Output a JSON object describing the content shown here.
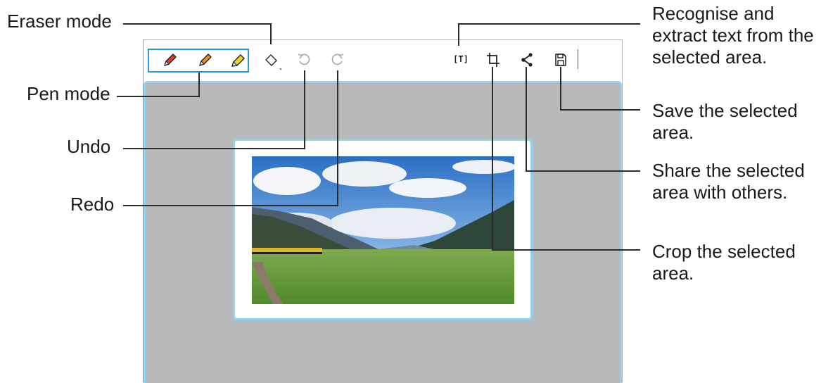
{
  "callouts": {
    "eraser": "Eraser mode",
    "pen": "Pen mode",
    "undo": "Undo",
    "redo": "Redo",
    "recognise": [
      "Recognise and",
      "extract text from the",
      "selected area."
    ],
    "save": [
      "Save the selected",
      "area."
    ],
    "share": [
      "Share the selected",
      "area with others."
    ],
    "crop": [
      "Crop the selected",
      "area."
    ]
  },
  "toolbar": {
    "icons": [
      "red-pen-icon",
      "orange-pen-icon",
      "yellow-highlighter-icon",
      "eraser-icon",
      "undo-icon",
      "redo-icon",
      "text-recognition-icon",
      "crop-icon",
      "share-icon",
      "save-icon"
    ],
    "text_recognition_glyph": "[T]"
  },
  "colors": {
    "callout_box": "#2a9bd5",
    "selection_border": "#8fd3f3",
    "workarea": "#b8b9bb",
    "pen_red": "#e03a2f",
    "pen_orange": "#f08a24",
    "pen_yellow": "#f2d32b"
  }
}
